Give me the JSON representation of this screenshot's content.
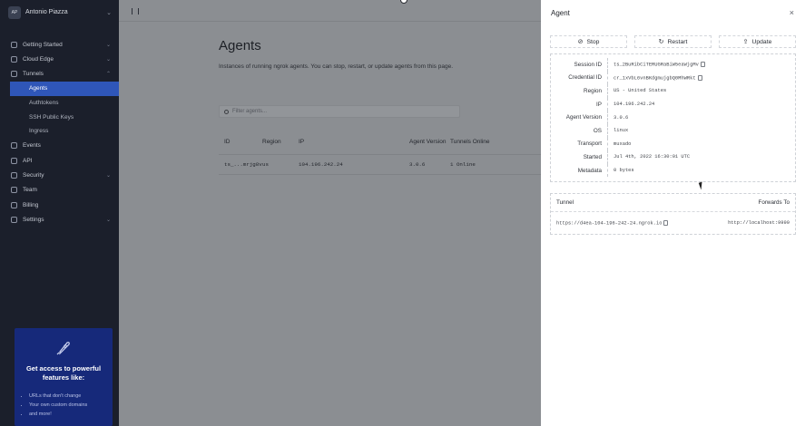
{
  "user": {
    "initials": "AP",
    "name": "Antonio Piazza"
  },
  "nav": {
    "getting_started": "Getting Started",
    "cloud_edge": "Cloud Edge",
    "tunnels": "Tunnels",
    "tunnels_sub": [
      "Agents",
      "Authtokens",
      "SSH Public Keys",
      "Ingress"
    ],
    "events": "Events",
    "api": "API",
    "security": "Security",
    "team": "Team",
    "billing": "Billing",
    "settings": "Settings"
  },
  "promo": {
    "title": "Get access to powerful features like:",
    "bullets": [
      "URLs that don't change",
      "Your own custom domains",
      "and more!"
    ]
  },
  "main": {
    "title": "Agents",
    "description": "Instances of running ngrok agents. You can stop, restart, or update agents from this page.",
    "search_placeholder": "Filter agents...",
    "columns": [
      "ID",
      "Region",
      "IP",
      "Agent Version",
      "Tunnels Online"
    ],
    "rows": [
      {
        "id": "ts_...mrjg8v",
        "region": "us",
        "ip": "104.196.242.24",
        "version": "3.0.6",
        "tunnels": "1 Online"
      }
    ]
  },
  "drawer": {
    "title": "Agent",
    "close": "×",
    "actions": {
      "stop": "Stop",
      "restart": "Restart",
      "update": "Update"
    },
    "details": [
      {
        "label": "Session ID",
        "value": "ts_2BuRibCiTERUGRaBiW5eaWjgMv"
      },
      {
        "label": "Credential ID",
        "value": "cr_1xVbL6vnBKdgmujgbQ0MhWRkt"
      },
      {
        "label": "Region",
        "value": "US - United States"
      },
      {
        "label": "IP",
        "value": "104.196.242.24"
      },
      {
        "label": "Agent Version",
        "value": "3.0.6"
      },
      {
        "label": "OS",
        "value": "linux"
      },
      {
        "label": "Transport",
        "value": "muxado"
      },
      {
        "label": "Started",
        "value": "Jul 4th, 2022 16:30:01 UTC"
      },
      {
        "label": "Metadata",
        "value": "0 bytes"
      }
    ],
    "tunnels": {
      "col_tunnel": "Tunnel",
      "col_forwards": "Forwards To",
      "rows": [
        {
          "tunnel": "https://d4ea-104-196-242-24.ngrok.io",
          "forwards": "http://localhost:9999"
        }
      ]
    }
  },
  "colors": {
    "sidebar": "#1b1f2b",
    "active": "#2f56b8",
    "promo": "#16297a",
    "overlay": "#8b8e92"
  }
}
